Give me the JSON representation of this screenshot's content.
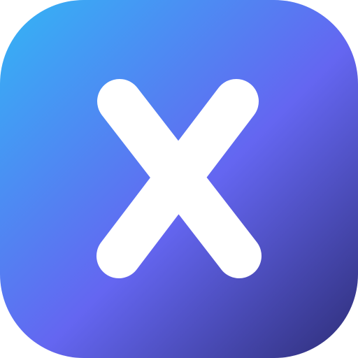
{
  "icon": {
    "name": "close-x-icon",
    "colors": {
      "gradient_top_left": "#33B5F5",
      "gradient_middle": "#6466F1",
      "gradient_bottom_right": "#2E2E78",
      "glyph": "#FFFFFF"
    }
  }
}
